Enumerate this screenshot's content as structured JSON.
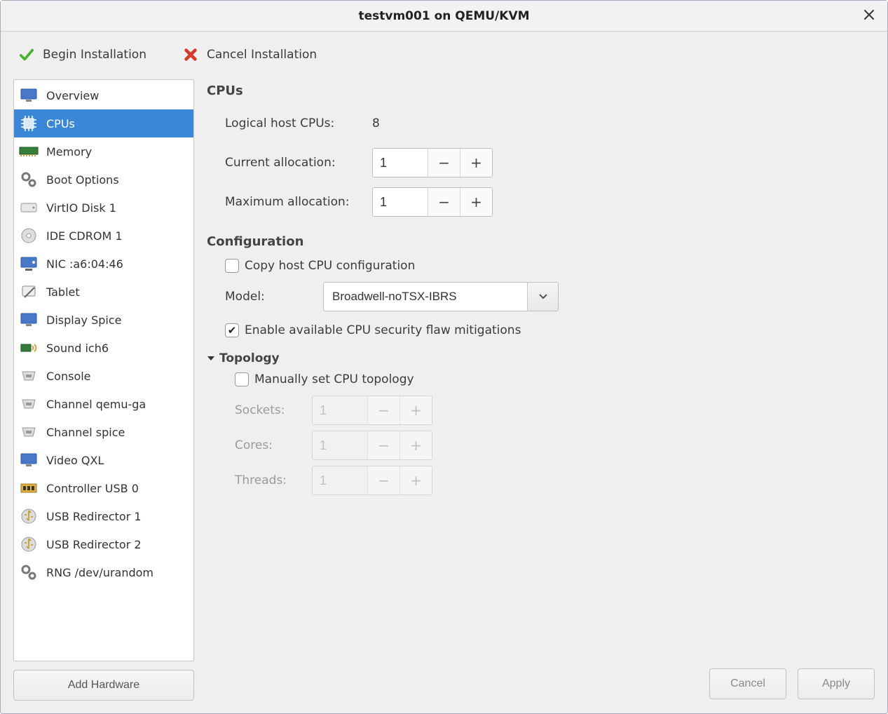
{
  "title": "testvm001 on QEMU/KVM",
  "toolbar": {
    "begin_label": "Begin Installation",
    "cancel_label": "Cancel Installation"
  },
  "sidebar": {
    "items": [
      {
        "label": "Overview",
        "icon": "monitor"
      },
      {
        "label": "CPUs",
        "icon": "cpu",
        "selected": true
      },
      {
        "label": "Memory",
        "icon": "memory"
      },
      {
        "label": "Boot Options",
        "icon": "gears"
      },
      {
        "label": "VirtIO Disk 1",
        "icon": "disk"
      },
      {
        "label": "IDE CDROM 1",
        "icon": "cdrom"
      },
      {
        "label": "NIC :a6:04:46",
        "icon": "nic"
      },
      {
        "label": "Tablet",
        "icon": "tablet"
      },
      {
        "label": "Display Spice",
        "icon": "display"
      },
      {
        "label": "Sound ich6",
        "icon": "sound"
      },
      {
        "label": "Console",
        "icon": "serial"
      },
      {
        "label": "Channel qemu-ga",
        "icon": "serial"
      },
      {
        "label": "Channel spice",
        "icon": "serial"
      },
      {
        "label": "Video QXL",
        "icon": "display"
      },
      {
        "label": "Controller USB 0",
        "icon": "controller"
      },
      {
        "label": "USB Redirector 1",
        "icon": "usb"
      },
      {
        "label": "USB Redirector 2",
        "icon": "usb"
      },
      {
        "label": "RNG /dev/urandom",
        "icon": "gears"
      }
    ],
    "add_hardware_label": "Add Hardware"
  },
  "cpus": {
    "section_title": "CPUs",
    "host_label": "Logical host CPUs:",
    "host_value": "8",
    "current_label": "Current allocation:",
    "current_value": "1",
    "max_label": "Maximum allocation:",
    "max_value": "1"
  },
  "configuration": {
    "section_title": "Configuration",
    "copy_host_label": "Copy host CPU configuration",
    "copy_host_checked": false,
    "model_label": "Model:",
    "model_value": "Broadwell-noTSX-IBRS",
    "mitigations_label": "Enable available CPU security flaw mitigations",
    "mitigations_checked": true
  },
  "topology": {
    "header_label": "Topology",
    "manual_label": "Manually set CPU topology",
    "manual_checked": false,
    "sockets_label": "Sockets:",
    "sockets_value": "1",
    "cores_label": "Cores:",
    "cores_value": "1",
    "threads_label": "Threads:",
    "threads_value": "1"
  },
  "footer": {
    "cancel_label": "Cancel",
    "apply_label": "Apply"
  }
}
